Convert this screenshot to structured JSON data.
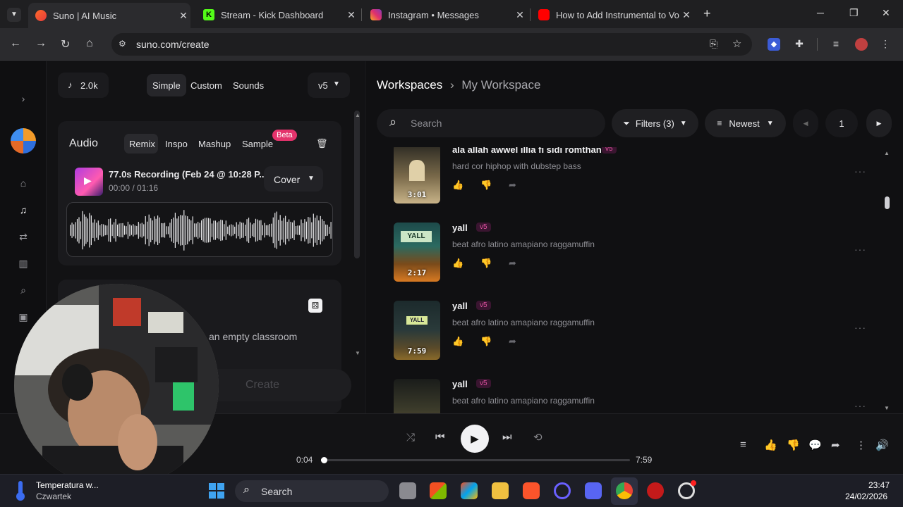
{
  "browser": {
    "tabs": [
      {
        "title": "Suno | AI Music",
        "active": true
      },
      {
        "title": "Stream - Kick Dashboard",
        "active": false
      },
      {
        "title": "Instagram • Messages",
        "active": false
      },
      {
        "title": "How to Add Instrumental to Vo",
        "active": false
      }
    ],
    "url": "suno.com/create"
  },
  "create_panel": {
    "credits": "2.0k",
    "modes": [
      "Simple",
      "Custom",
      "Sounds"
    ],
    "active_mode": "Simple",
    "model": "v5",
    "audio": {
      "heading": "Audio",
      "tabs": [
        "Remix",
        "Inspo",
        "Mashup",
        "Sample"
      ],
      "active_tab": "Remix",
      "beta_label": "Beta",
      "recording_title": "77.0s Recording (Feb 24 @ 10:28 P...",
      "recording_time": "00:00 / 01:16",
      "cover_label": "Cover"
    },
    "prompt_fragment": "an empty classroom",
    "create_label": "Create"
  },
  "workspace": {
    "breadcrumb_root": "Workspaces",
    "breadcrumb_current": "My Workspace",
    "search_placeholder": "Search",
    "filters_label": "Filters (3)",
    "sort_label": "Newest",
    "page": "1",
    "songs": [
      {
        "title": "ala allah awwel illia fi sidi romthan",
        "version": "v5",
        "description": "hard cor hiphop with dubstep bass",
        "duration": "3:01"
      },
      {
        "title": "yall",
        "version": "v5",
        "description": "beat afro latino amapiano raggamuffin",
        "duration": "2:17"
      },
      {
        "title": "yall",
        "version": "v5",
        "description": "beat afro latino amapiano raggamuffin",
        "duration": "7:59"
      },
      {
        "title": "yall",
        "version": "v5",
        "description": "beat afro latino amapiano raggamuffin",
        "duration": ""
      }
    ]
  },
  "player": {
    "elapsed": "0:04",
    "total": "7:59",
    "progress": 0.0085
  },
  "taskbar": {
    "weather_title": "Temperatura w...",
    "weather_day": "Czwartek",
    "search_label": "Search",
    "clock_time": "23:47",
    "clock_date": "24/02/2026"
  },
  "colors": {
    "accent_pink": "#e4336c",
    "version_badge": "#e052a0",
    "background": "#101012"
  }
}
